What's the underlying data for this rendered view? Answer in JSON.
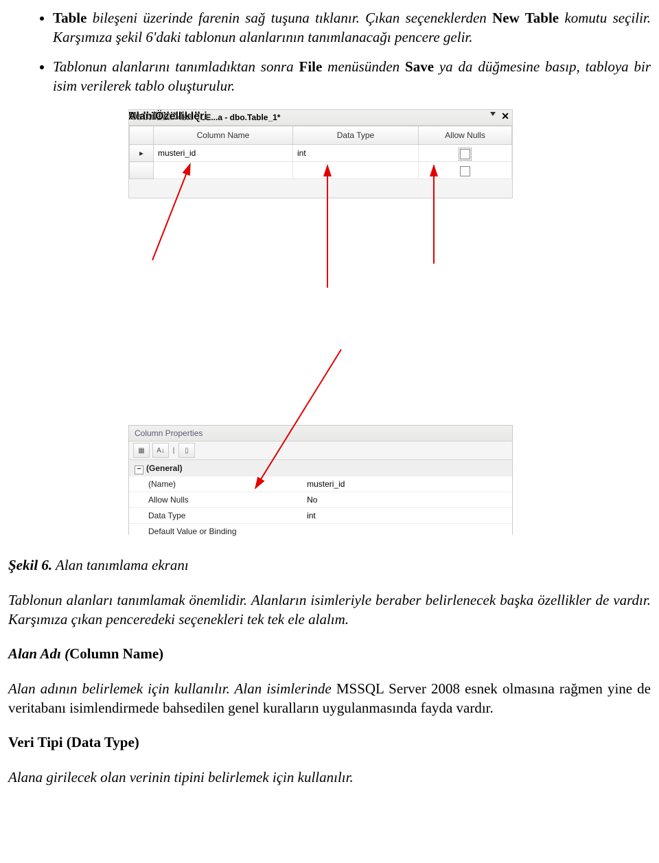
{
  "bullets": [
    {
      "pre": "Table",
      "mid1": " bileşeni üzerinde farenin sağ tuşuna tıklanır. Çıkan seçeneklerden ",
      "bold2": "New Table",
      "post": " komutu seçilir. Karşımıza şekil 6'daki tablonun alanlarının tanımlanacağı pencere gelir."
    },
    {
      "pre": "",
      "mid1": "Tablonun alanlarını tanımladıktan sonra ",
      "bold2": "File",
      "mid2": " menüsünden ",
      "bold3": "Save",
      "post": " ya da düğmesine basıp, tabloya bir isim verilerek tablo oluşturulur."
    }
  ],
  "screenshot": {
    "tab_title": "ANKUZEM-42\\SQLE...a - dbo.Table_1*",
    "grid_headers": {
      "col": "Column Name",
      "type": "Data Type",
      "nulls": "Allow Nulls"
    },
    "row_marker": "▸",
    "row": {
      "col": "musteri_id",
      "type": "int"
    },
    "properties": {
      "title": "Column Properties",
      "category": "(General)",
      "rows": [
        {
          "k": "(Name)",
          "v": "musteri_id"
        },
        {
          "k": "Allow Nulls",
          "v": "No"
        },
        {
          "k": "Data Type",
          "v": "int"
        },
        {
          "k": "Default Value or Binding",
          "v": ""
        }
      ]
    },
    "annotations": {
      "alan_adi": "Alan Adı",
      "veri_turu": "Veri Türü",
      "null": "Null / Not Null",
      "ozellik": "Alan Özellikleri"
    }
  },
  "caption_bold": "Şekil 6.",
  "caption_rest": " Alan tanımlama ekranı",
  "para1": "Tablonun alanları tanımlamak önemlidir. Alanların isimleriyle beraber belirlenecek başka özellikler de vardır. Karşımıza çıkan penceredeki seçenekleri tek tek ele alalım.",
  "sub1_bold": "Alan Adı (",
  "sub1_bold2": "Column Name",
  "sub1_bold3": ")",
  "para2_a": "Alan adının belirlemek için kullanılır. Alan isimlerinde ",
  "para2_mid": "MSSQL Server 2008 esnek olmasına rağmen yine de veritabanı isimlendirmede bahsedilen genel kuralların uygulanmasında fayda vardır.",
  "sub2": "Veri Tipi (Data Type)",
  "para3": "Alana girilecek olan verinin tipini belirlemek için kullanılır."
}
